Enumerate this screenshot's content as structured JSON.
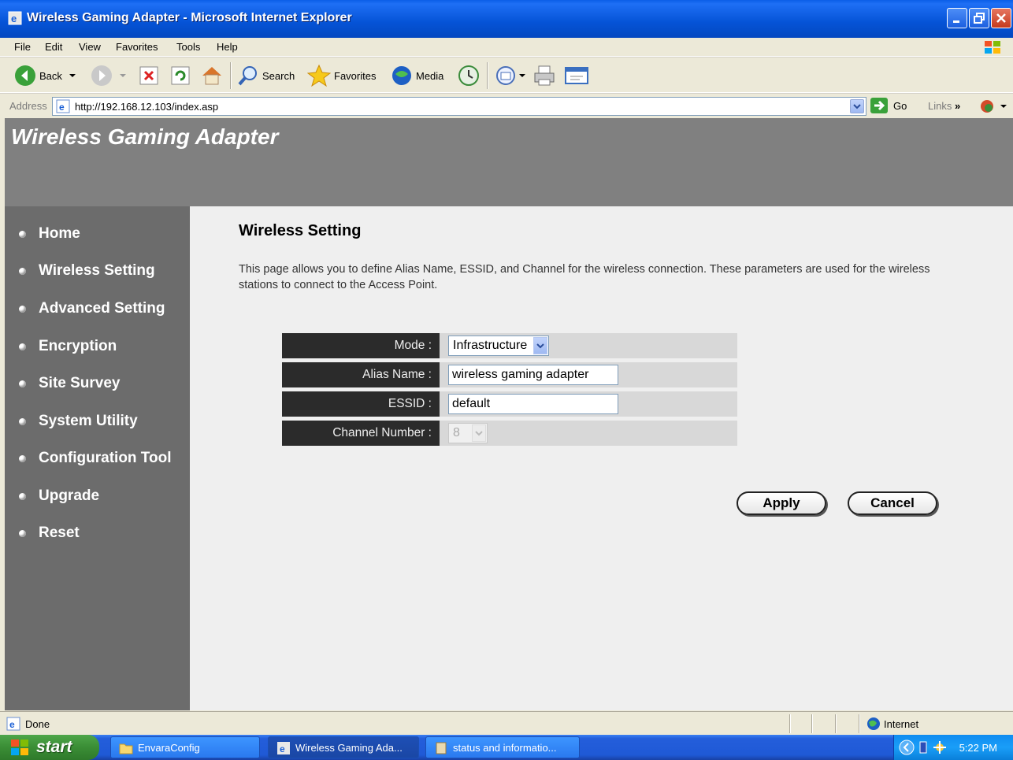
{
  "window": {
    "title": "Wireless Gaming Adapter - Microsoft Internet Explorer"
  },
  "menu": [
    "File",
    "Edit",
    "View",
    "Favorites",
    "Tools",
    "Help"
  ],
  "toolbar": {
    "back": "Back",
    "search": "Search",
    "favorites": "Favorites",
    "media": "Media"
  },
  "address": {
    "label": "Address",
    "url": "http://192.168.12.103/index.asp",
    "go": "Go",
    "links": "Links"
  },
  "page": {
    "banner": "Wireless Gaming Adapter",
    "nav": [
      "Home",
      "Wireless Setting",
      "Advanced Setting",
      "Encryption",
      "Site Survey",
      "System Utility",
      "Configuration Tool",
      "Upgrade",
      "Reset"
    ],
    "heading": "Wireless Setting",
    "description": "This page allows you to define Alias Name, ESSID, and Channel for the wireless connection. These parameters are used for the wireless stations to connect to the Access Point.",
    "form": {
      "mode_label": "Mode :",
      "mode_value": "Infrastructure",
      "alias_label": "Alias Name :",
      "alias_value": "wireless gaming adapter",
      "essid_label": "ESSID :",
      "essid_value": "default",
      "channel_label": "Channel Number :",
      "channel_value": "8"
    },
    "apply": "Apply",
    "cancel": "Cancel"
  },
  "status": {
    "text": "Done",
    "zone": "Internet"
  },
  "taskbar": {
    "start": "start",
    "tasks": [
      "EnvaraConfig",
      "Wireless Gaming Ada...",
      "status and informatio..."
    ],
    "clock": "5:22 PM"
  },
  "colors": {
    "banner": "#808080",
    "sidebar": "#6c6c6c",
    "label_bg": "#2b2b2b",
    "titlebar": "#0553d6"
  }
}
